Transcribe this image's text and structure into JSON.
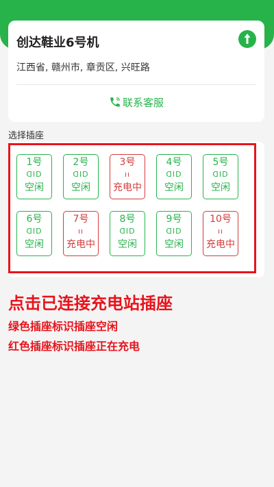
{
  "station": {
    "name": "创达鞋业6号机",
    "address": "江西省, 赣州市, 章贡区, 兴旺路",
    "contact_label": "联系客服"
  },
  "section_label": "选择插座",
  "sockets": [
    {
      "num": "1号",
      "status": "空闲",
      "state": "idle",
      "plug": "ᗡID"
    },
    {
      "num": "2号",
      "status": "空闲",
      "state": "idle",
      "plug": "ᗡID"
    },
    {
      "num": "3号",
      "status": "充电中",
      "state": "busy",
      "plug": "ıı"
    },
    {
      "num": "4号",
      "status": "空闲",
      "state": "idle",
      "plug": "ᗡID"
    },
    {
      "num": "5号",
      "status": "空闲",
      "state": "idle",
      "plug": "ᗡID"
    },
    {
      "num": "6号",
      "status": "空闲",
      "state": "idle",
      "plug": "ᗡID"
    },
    {
      "num": "7号",
      "status": "充电中",
      "state": "busy",
      "plug": "ıı"
    },
    {
      "num": "8号",
      "status": "空闲",
      "state": "idle",
      "plug": "ᗡID"
    },
    {
      "num": "9号",
      "status": "空闲",
      "state": "idle",
      "plug": "ᗡID"
    },
    {
      "num": "10号",
      "status": "充电中",
      "state": "busy",
      "plug": "ıı"
    }
  ],
  "notes": {
    "main": "点击已连接充电站插座",
    "green": "绿色插座标识插座空闲",
    "red": "红色插座标识插座正在充电"
  },
  "colors": {
    "accent": "#27b34a",
    "busy": "#d43b3b",
    "annotation": "#e8131b"
  },
  "icons": {
    "navigate": "navigation-arrow-icon",
    "phone": "phone-icon"
  }
}
